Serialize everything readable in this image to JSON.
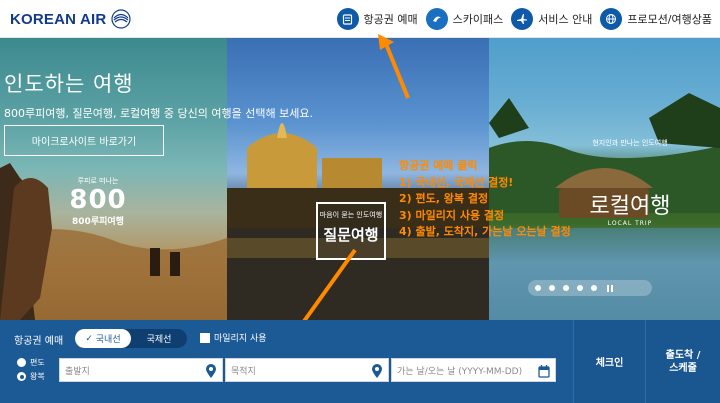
{
  "header": {
    "logo_text": "KOREAN AIR",
    "nav": [
      {
        "label": "항공권 예매",
        "icon": "ticket-icon"
      },
      {
        "label": "스카이패스",
        "icon": "skypass-icon"
      },
      {
        "label": "서비스 안내",
        "icon": "airplane-icon"
      },
      {
        "label": "프로모션/여행상품",
        "icon": "globe-icon"
      }
    ]
  },
  "hero": {
    "title": "인도하는 여행",
    "subtitle": "800루피여행, 질문여행, 로컬여행 중 당신의 여행을 선택해 보세요.",
    "microsite_button": "마이크로사이트 바로가기",
    "badge_800": {
      "small": "루피로 떠나는",
      "big": "800",
      "caption": "800루피여행"
    },
    "badge_question": {
      "small": "마음이 묻는 인도여행",
      "big": "질문여행"
    },
    "badge_local": {
      "small": "현지인과 만나는 인도여행",
      "big": "로컬여행",
      "caption": "LOCAL TRIP"
    },
    "carousel_dots": 5
  },
  "annotation": {
    "lines": [
      "항공권 예매 클릭",
      "1) 국내선, 국제선 결정!",
      "2) 편도, 왕복 결정",
      "3) 마일리지 사용 결정",
      "4) 출발, 도착지, 가는날 오는날 결정"
    ],
    "color": "#ff8a00"
  },
  "booking": {
    "label": "항공권 예매",
    "tabs": [
      "국내선",
      "국제선"
    ],
    "active_tab": 0,
    "mileage_label": "마일리지 사용",
    "trip_options": [
      "편도",
      "왕복"
    ],
    "selected_trip": 1,
    "origin_placeholder": "출발지",
    "destination_placeholder": "목적지",
    "date_placeholder": "가는 날/오는 날 (YYYY-MM-DD)",
    "checkin_label": "체크인",
    "schedule_label_1": "출도착 /",
    "schedule_label_2": "스케줄"
  },
  "colors": {
    "brand": "#123a8a",
    "booking_bg": "#1c5a95",
    "accent": "#ff8a00"
  }
}
